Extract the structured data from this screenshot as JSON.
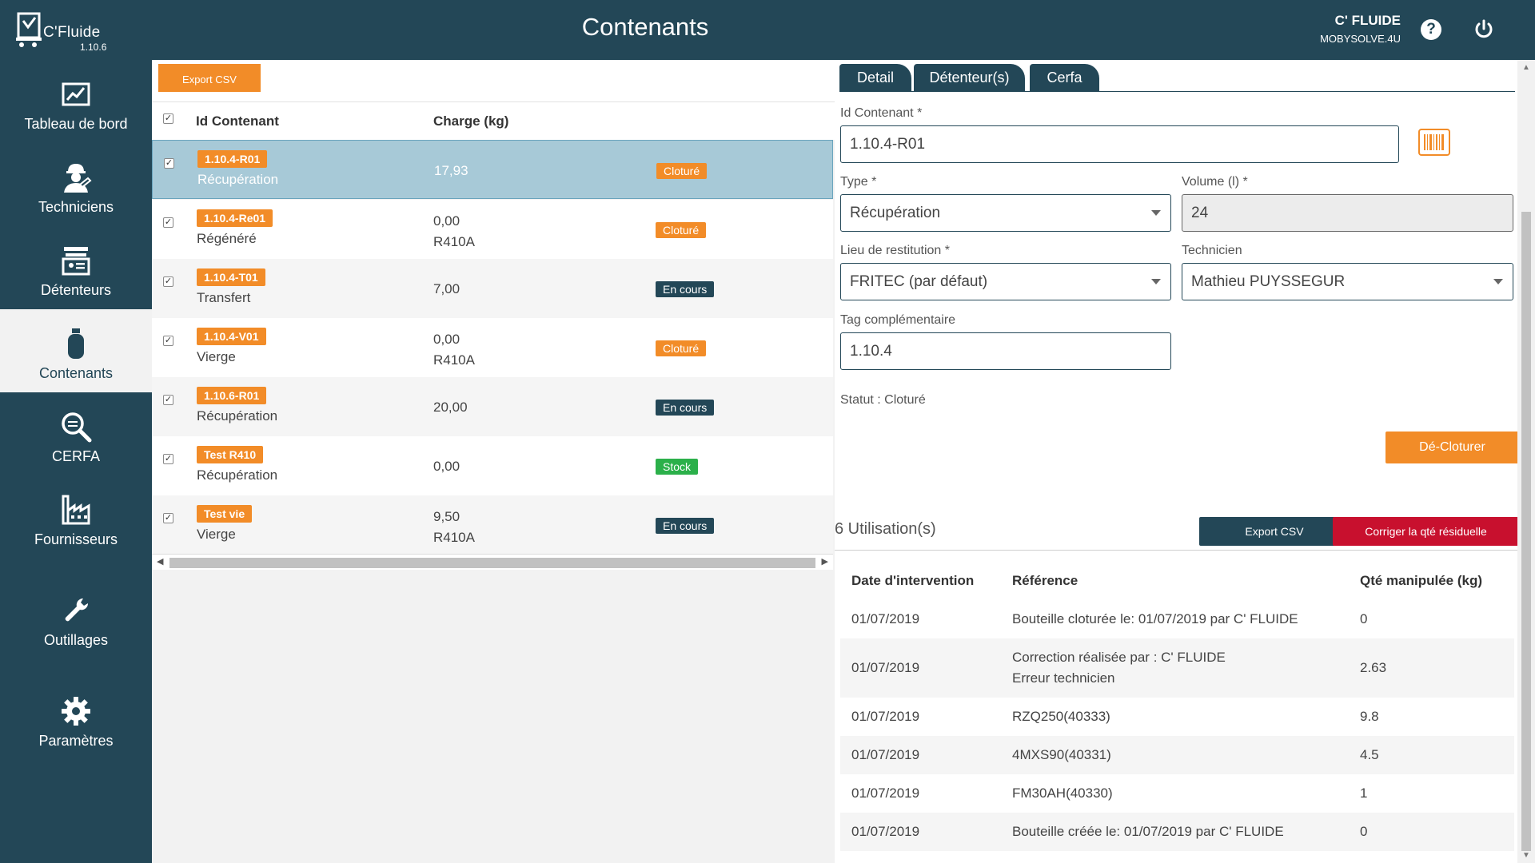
{
  "header": {
    "logo_name": "C'Fluide",
    "logo_version": "1.10.6",
    "title": "Contenants",
    "user_name": "C' FLUIDE",
    "user_org": "MOBYSOLVE.4U",
    "help_label": "?"
  },
  "sidebar": {
    "items": [
      {
        "label": "Tableau de bord",
        "icon": "chart-icon"
      },
      {
        "label": "Techniciens",
        "icon": "technician-icon"
      },
      {
        "label": "Détenteurs",
        "icon": "holder-icon"
      },
      {
        "label": "Contenants",
        "icon": "cylinder-icon"
      },
      {
        "label": "CERFA",
        "icon": "search-doc-icon"
      },
      {
        "label": "Fournisseurs",
        "icon": "factory-icon"
      },
      {
        "label": "Outillages",
        "icon": "wrench-icon"
      },
      {
        "label": "Paramètres",
        "icon": "gear-icon"
      }
    ]
  },
  "left": {
    "export_label": "Export CSV",
    "columns": [
      "Id Contenant",
      "Charge (kg)"
    ],
    "rows": [
      {
        "id": "1.10.4-R01",
        "type": "Récupération",
        "charge": "17,93",
        "gas": "",
        "status": "Cloturé",
        "status_kind": "clos"
      },
      {
        "id": "1.10.4-Re01",
        "type": "Régénéré",
        "charge": "0,00",
        "gas": "R410A",
        "status": "Cloturé",
        "status_kind": "clos"
      },
      {
        "id": "1.10.4-T01",
        "type": "Transfert",
        "charge": "7,00",
        "gas": "",
        "status": "En cours",
        "status_kind": "cours"
      },
      {
        "id": "1.10.4-V01",
        "type": "Vierge",
        "charge": "0,00",
        "gas": "R410A",
        "status": "Cloturé",
        "status_kind": "clos"
      },
      {
        "id": "1.10.6-R01",
        "type": "Récupération",
        "charge": "20,00",
        "gas": "",
        "status": "En cours",
        "status_kind": "cours"
      },
      {
        "id": "Test R410",
        "type": "Récupération",
        "charge": "0,00",
        "gas": "",
        "status": "Stock",
        "status_kind": "stock"
      },
      {
        "id": "Test vie",
        "type": "Vierge",
        "charge": "9,50",
        "gas": "R410A",
        "status": "En cours",
        "status_kind": "cours"
      }
    ]
  },
  "detail": {
    "tabs": [
      "Detail",
      "Détenteur(s)",
      "Cerfa"
    ],
    "id_label": "Id Contenant *",
    "id_value": "1.10.4-R01",
    "type_label": "Type *",
    "type_value": "Récupération",
    "volume_label": "Volume (l) *",
    "volume_value": "24",
    "lieu_label": "Lieu de restitution *",
    "lieu_value": "FRITEC (par défaut)",
    "tech_label": "Technicien",
    "tech_value": "Mathieu PUYSSEGUR",
    "tag_label": "Tag complémentaire",
    "tag_value": "1.10.4",
    "statut": "Statut : Cloturé",
    "decloturer_label": "Dé-Cloturer"
  },
  "utilisations": {
    "title": "6 Utilisation(s)",
    "export_label": "Export CSV",
    "corriger_label": "Corriger la qté résiduelle",
    "columns": [
      "Date d'intervention",
      "Référence",
      "Qté manipulée (kg)"
    ],
    "rows": [
      {
        "date": "01/07/2019",
        "ref": "Bouteille cloturée le: 01/07/2019 par C' FLUIDE",
        "ref2": "",
        "qte": "0"
      },
      {
        "date": "01/07/2019",
        "ref": "Correction réalisée par : C' FLUIDE",
        "ref2": "Erreur technicien",
        "qte": "2.63"
      },
      {
        "date": "01/07/2019",
        "ref": "RZQ250(40333)",
        "ref2": "",
        "qte": "9.8"
      },
      {
        "date": "01/07/2019",
        "ref": "4MXS90(40331)",
        "ref2": "",
        "qte": "4.5"
      },
      {
        "date": "01/07/2019",
        "ref": "FM30AH(40330)",
        "ref2": "",
        "qte": "1"
      },
      {
        "date": "01/07/2019",
        "ref": "Bouteille créée le: 01/07/2019 par C' FLUIDE",
        "ref2": "",
        "qte": "0"
      }
    ]
  },
  "colors": {
    "primary": "#234757",
    "accent": "#f28c28",
    "danger": "#c8102e",
    "success": "#2bb04a",
    "selected_row": "#a7c9d7"
  }
}
